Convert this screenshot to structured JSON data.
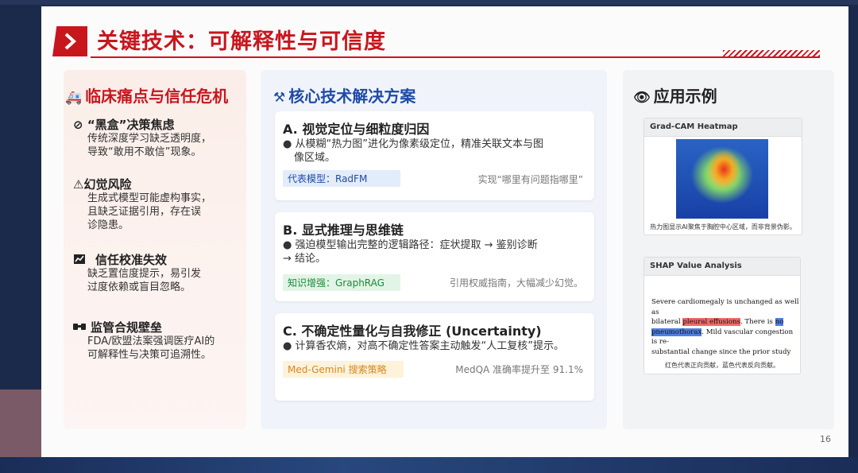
{
  "title": "关键技术：可解释性与可信度",
  "page_number": "16",
  "left": {
    "heading": "临床痛点与信任危机",
    "items": [
      {
        "icon": "⊘",
        "title": "“黑盒”决策焦虑",
        "body": [
          "传统深度学习缺乏透明度，",
          "导致“敢用不敢信”现象。"
        ]
      },
      {
        "icon": "⚠",
        "title": "幻觉风险",
        "body": [
          "生成式模型可能虚构事实，",
          "且缺乏证据引用，存在误",
          "诊隐患。"
        ]
      },
      {
        "icon": "",
        "title": "信任校准失效",
        "body": [
          "缺乏置信度提示，易引发",
          "过度依赖或盲目忽略。"
        ]
      },
      {
        "icon": "",
        "title": "监管合规壁垒",
        "body": [
          "FDA/欧盟法案强调医疗AI的",
          "可解释性与决策可追溯性。"
        ]
      }
    ]
  },
  "middle": {
    "heading": "核心技术解决方案",
    "cards": [
      {
        "title": "A. 视觉定位与细粒度归因",
        "body": [
          "● 从模糊“热力图”进化为像素级定位，精准关联文本与图",
          "像区域。"
        ],
        "tag": "代表模型：RadFM",
        "note": "实现“哪里有问题指哪里”",
        "tag_color": "#1f4aa8",
        "tag_bg": "#e3ecfa"
      },
      {
        "title": "B. 显式推理与思维链",
        "body": [
          "● 强迫模型输出完整的逻辑路径：症状提取 → 鉴别诊断",
          "→ 结论。"
        ],
        "tag": "知识增强：GraphRAG",
        "note": "引用权威指南，大幅减少幻觉。",
        "tag_color": "#1c8a3a",
        "tag_bg": "#e2f4e6"
      },
      {
        "title": "C. 不确定性量化与自我修正 (Uncertainty)",
        "body": [
          "● 计算香农熵，对高不确定性答案主动触发“人工复核”提示。"
        ],
        "tag": "Med-Gemini 搜索策略",
        "note": "MedQA 准确率提升至 91.1%",
        "tag_color": "#d9861a",
        "tag_bg": "#fdf2dc"
      }
    ]
  },
  "right": {
    "heading": "应用示例",
    "gradcam": {
      "label": "Grad-CAM Heatmap",
      "caption": "热力图显示AI聚焦于胸腔中心区域，而非背景伪影。"
    },
    "shap": {
      "label": "SHAP Value Analysis",
      "lines": [
        [
          "Severe cardiomegaly is unchanged as well as"
        ],
        [
          "bilateral ",
          "pleural effusions",
          ". There is ",
          "no"
        ],
        [
          "pneumothorax",
          ". Mild vascular congestion is re-"
        ],
        [
          "substantial change since the prior study"
        ]
      ],
      "caption": "红色代表正向贡献，蓝色代表反向贡献。"
    }
  },
  "colors": {
    "accent": "#c8161d",
    "blue": "#1f4aa8"
  }
}
